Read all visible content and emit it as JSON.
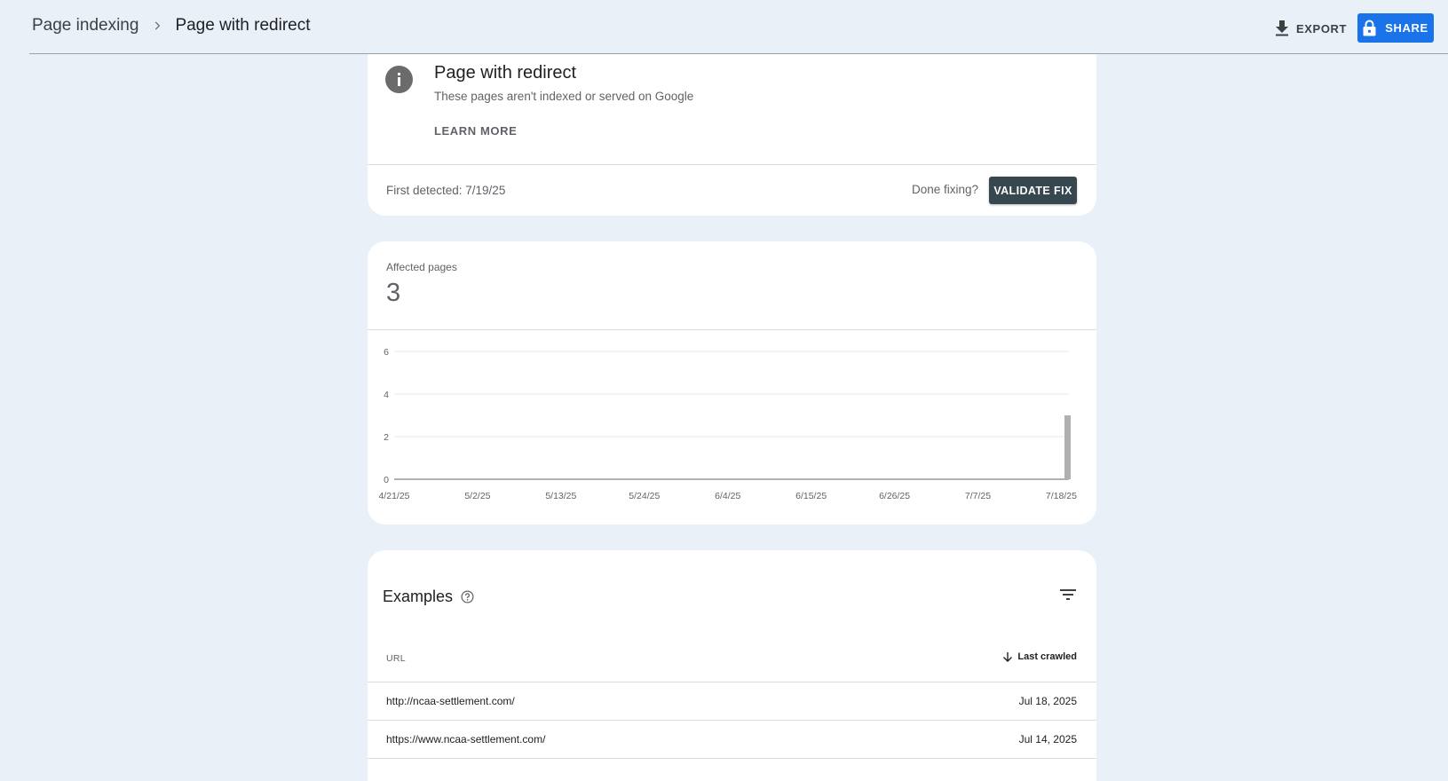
{
  "header": {
    "breadcrumb_parent": "Page indexing",
    "breadcrumb_current": "Page with redirect",
    "export_label": "EXPORT",
    "share_label": "SHARE"
  },
  "issue": {
    "title": "Page with redirect",
    "subtitle": "These pages aren't indexed or served on Google",
    "learn_more": "LEARN MORE",
    "first_detected": "First detected: 7/19/25",
    "done_fixing": "Done fixing?",
    "validate_label": "VALIDATE FIX",
    "icon": "info-icon"
  },
  "affected": {
    "label": "Affected pages",
    "value": "3"
  },
  "chart_data": {
    "type": "bar",
    "title": "",
    "xlabel": "",
    "ylabel": "",
    "ylim": [
      0,
      6
    ],
    "yticks": [
      "0",
      "2",
      "4",
      "6"
    ],
    "xticks": [
      "4/21/25",
      "5/2/25",
      "5/13/25",
      "5/24/25",
      "6/4/25",
      "6/15/25",
      "6/26/25",
      "7/7/25",
      "7/18/25"
    ],
    "x_start": "4/21/25",
    "x_end": "7/19/25",
    "bars": [
      {
        "x": "7/19/25",
        "value": 3
      }
    ],
    "grid": true,
    "bar_color": "#b0b0b0"
  },
  "examples": {
    "title": "Examples",
    "col_url": "URL",
    "col_crawled": "Last crawled",
    "rows": [
      {
        "url": "http://ncaa-settlement.com/",
        "date": "Jul 18, 2025"
      },
      {
        "url": "https://www.ncaa-settlement.com/",
        "date": "Jul 14, 2025"
      }
    ]
  },
  "colors": {
    "accent": "#1a73e8",
    "validate_button": "#37474f",
    "background": "#eaf0f8"
  }
}
